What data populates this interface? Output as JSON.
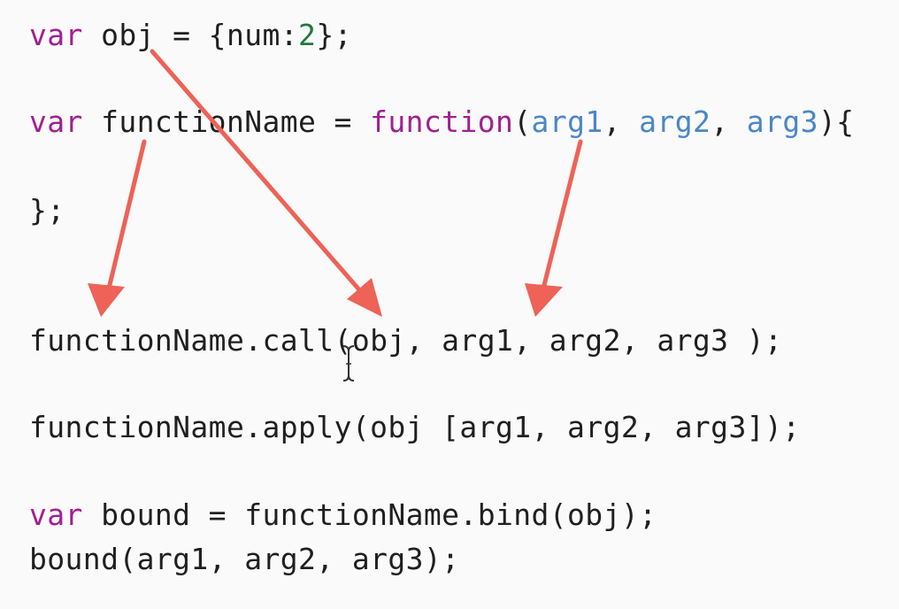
{
  "code": {
    "line1": {
      "kw": "var",
      "text1": " obj = {num:",
      "num": "2",
      "text2": "};"
    },
    "line2": {
      "kw": "var",
      "text1": " functionName = ",
      "kw2": "function",
      "paren_open": "(",
      "arg1": "arg1",
      "sep1": ", ",
      "arg2": "arg2",
      "sep2": ", ",
      "arg3": "arg3",
      "close": "){"
    },
    "line3": "};",
    "line4": "functionName.call(obj, arg1, arg2, arg3 );",
    "line5": "functionName.apply(obj [arg1, arg2, arg3]);",
    "line6": {
      "kw": "var",
      "text": " bound = functionName.bind(obj);"
    },
    "line7": "bound(arg1, arg2, arg3);"
  },
  "colors": {
    "keyword": "#a0208f",
    "number": "#1f7a3a",
    "argument": "#4a86c8",
    "text": "#1f1f1f",
    "arrow": "#ee6257",
    "background": "#fafafa"
  },
  "icons": {
    "cursor": "text-cursor-icon",
    "arrow": "red-annotation-arrow-icon"
  }
}
